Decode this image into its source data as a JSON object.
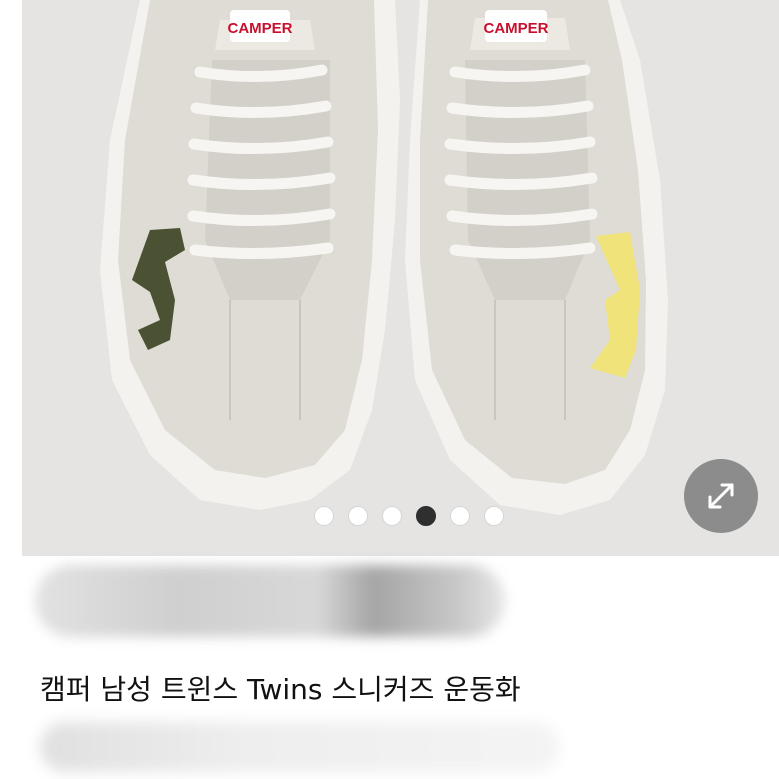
{
  "gallery": {
    "brand_logo_text": "CAMPER",
    "carousel": {
      "total": 6,
      "active_index": 3
    }
  },
  "product": {
    "title": "캠퍼 남성 트윈스 Twins 스니커즈 운동화"
  }
}
